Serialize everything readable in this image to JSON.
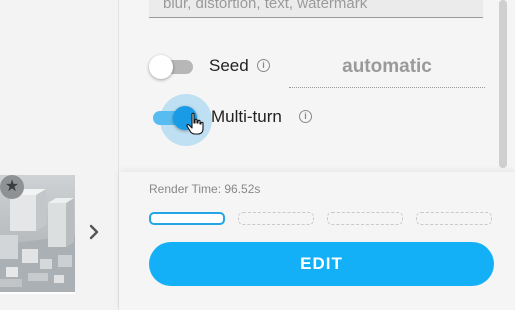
{
  "prompt": {
    "negative_text": "blur, distortion, text, watermark"
  },
  "options": {
    "seed": {
      "label": "Seed",
      "enabled": false,
      "value_placeholder": "automatic"
    },
    "multi_turn": {
      "label": "Multi-turn",
      "enabled": true
    }
  },
  "thumbnail": {
    "badge_icon": "star-icon"
  },
  "footer": {
    "render_time": "Render Time: 96.52s",
    "slots": [
      {
        "state": "active"
      },
      {
        "state": "empty"
      },
      {
        "state": "empty"
      },
      {
        "state": "empty"
      }
    ],
    "edit_label": "EDIT"
  },
  "colors": {
    "accent": "#13b0f7",
    "toggle_on_track": "#57bdf0",
    "toggle_on_knob": "#1a9be6",
    "toggle_off_track": "#b7b7b7",
    "toggle_off_knob": "#ffffff"
  },
  "icons": {
    "info": "info-icon",
    "next": "chevron-right-icon",
    "pointer": "hand-pointer-icon"
  }
}
